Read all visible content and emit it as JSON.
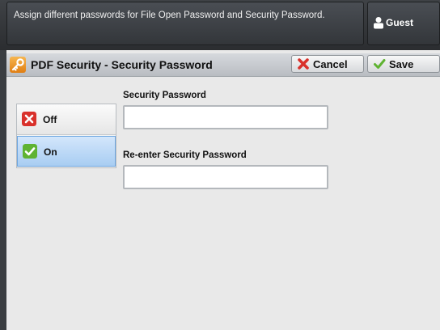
{
  "message": {
    "text": "Assign different passwords for File Open Password and Security Password."
  },
  "user": {
    "label": "Guest"
  },
  "titlebar": {
    "title": "PDF Security - Security Password"
  },
  "toolbar": {
    "cancel_label": "Cancel",
    "save_label": "Save"
  },
  "options": {
    "selected": "On",
    "items": [
      {
        "label": "Off",
        "icon": "x-icon",
        "color": "#d9312b"
      },
      {
        "label": "On",
        "icon": "check-icon",
        "color": "#5fb332"
      }
    ]
  },
  "fields": {
    "security_password": {
      "label": "Security Password",
      "value": "",
      "placeholder": ""
    },
    "reenter_password": {
      "label": "Re-enter Security Password",
      "value": "",
      "placeholder": ""
    }
  },
  "icons": {
    "title": "key-icon",
    "user": "user-icon"
  },
  "colors": {
    "accent_selected": "#a8cdf2",
    "cancel": "#d9312b",
    "save": "#5fb332"
  }
}
